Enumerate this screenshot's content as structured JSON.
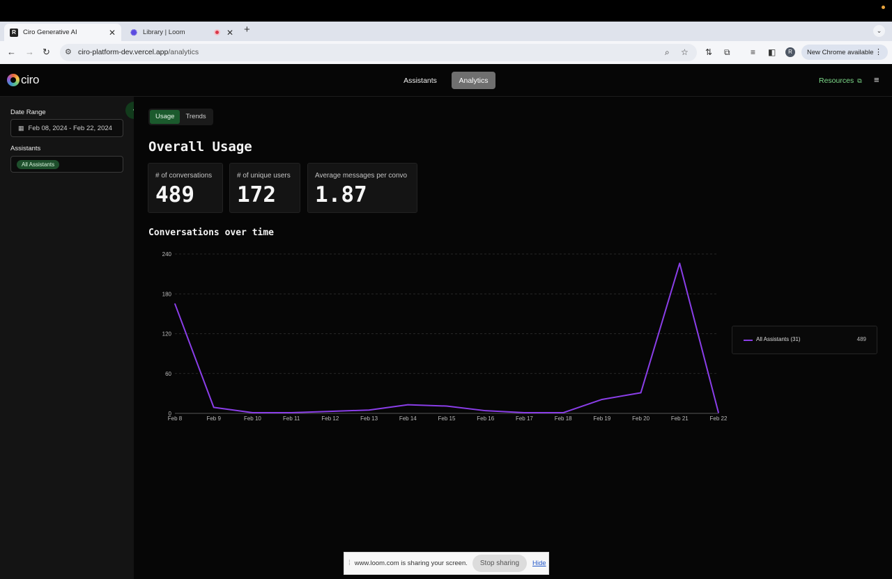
{
  "browser": {
    "tabs": [
      {
        "title": "Ciro Generative AI",
        "active": true
      },
      {
        "title": "Library | Loom",
        "active": false
      }
    ],
    "url_host": "ciro-platform-dev.vercel.app",
    "url_path": "/analytics",
    "new_chrome_label": "New Chrome available",
    "profile_initial": "R"
  },
  "app": {
    "logo_text": "ciro",
    "nav": {
      "assistants": "Assistants",
      "analytics": "Analytics"
    },
    "resources_label": "Resources"
  },
  "sidebar": {
    "date_range_label": "Date Range",
    "date_range_value": "Feb 08, 2024 - Feb 22, 2024",
    "assistants_label": "Assistants",
    "assistants_chip": "All Assistants"
  },
  "main": {
    "tabs": [
      {
        "label": "Usage",
        "active": true
      },
      {
        "label": "Trends",
        "active": false
      }
    ],
    "title": "Overall Usage",
    "stats": [
      {
        "label": "# of conversations",
        "value": "489"
      },
      {
        "label": "# of unique users",
        "value": "172"
      },
      {
        "label": "Average messages per convo",
        "value": "1.87"
      }
    ],
    "chart_title": "Conversations over time"
  },
  "chart_data": {
    "type": "line",
    "title": "Conversations over time",
    "x": [
      "Feb 8",
      "Feb 9",
      "Feb 10",
      "Feb 11",
      "Feb 12",
      "Feb 13",
      "Feb 14",
      "Feb 15",
      "Feb 16",
      "Feb 17",
      "Feb 18",
      "Feb 19",
      "Feb 20",
      "Feb 21",
      "Feb 22"
    ],
    "series": [
      {
        "name": "All Assistants (31)",
        "total": "489",
        "color": "#8a3ee8",
        "values": [
          165,
          9,
          1,
          1,
          3,
          5,
          13,
          11,
          4,
          1,
          1,
          21,
          31,
          226,
          1
        ]
      }
    ],
    "yticks": [
      0,
      60,
      120,
      180,
      240
    ],
    "ylim": [
      0,
      240
    ],
    "grid": true,
    "legend": "right"
  },
  "share_bar": {
    "message": "www.loom.com is sharing your screen.",
    "stop_label": "Stop sharing",
    "hide_label": "Hide"
  }
}
